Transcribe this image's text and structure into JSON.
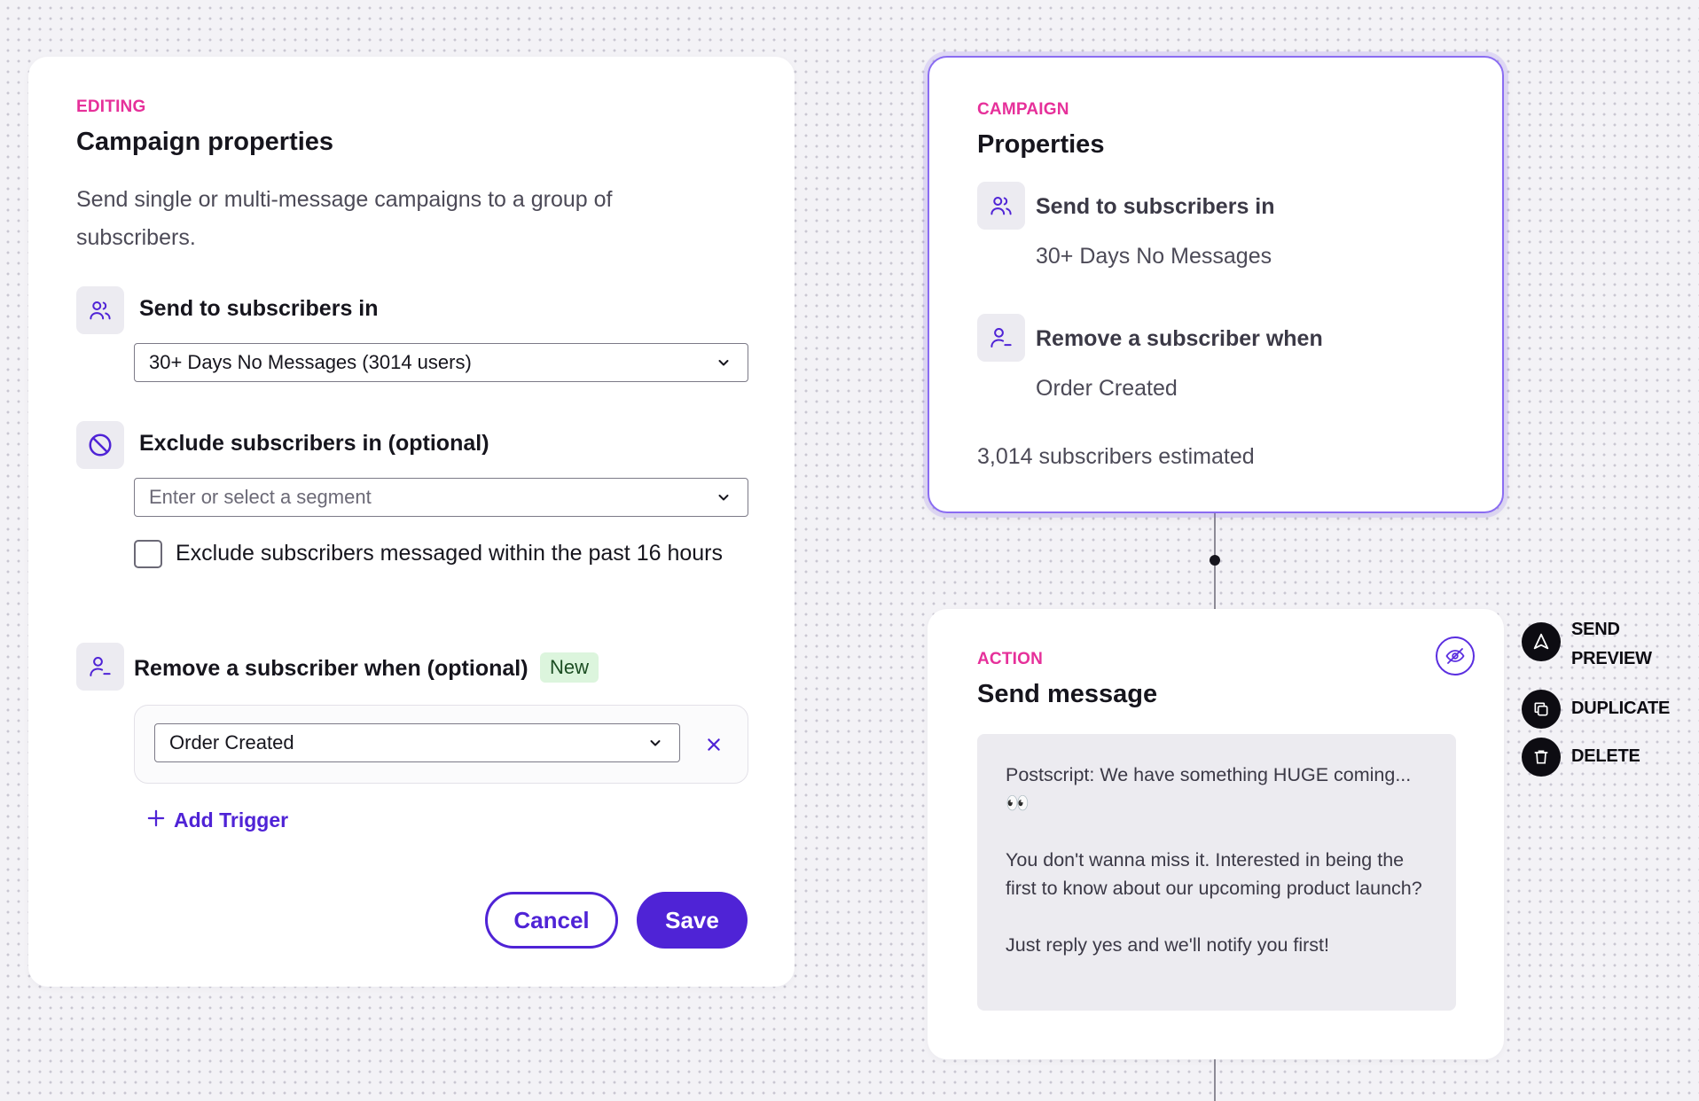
{
  "editor": {
    "eyebrow": "EDITING",
    "title": "Campaign properties",
    "description": "Send single or multi-message campaigns to a group of subscribers.",
    "send_to": {
      "label": "Send to subscribers in",
      "selected": "30+ Days No Messages (3014 users)"
    },
    "exclude": {
      "label": "Exclude subscribers in (optional)",
      "placeholder": "Enter or select a segment"
    },
    "recent_exclusion": {
      "label": "Exclude subscribers messaged within the past 16 hours",
      "checked": false
    },
    "remove_when": {
      "label": "Remove a subscriber when (optional)",
      "badge": "New",
      "trigger_selected": "Order Created"
    },
    "add_trigger_label": "Add Trigger",
    "cancel_label": "Cancel",
    "save_label": "Save"
  },
  "properties_card": {
    "eyebrow": "CAMPAIGN",
    "title": "Properties",
    "send_to_label": "Send to subscribers in",
    "send_to_value": "30+ Days No Messages",
    "remove_label": "Remove a subscriber when",
    "remove_value": "Order Created",
    "estimate": "3,014 subscribers estimated"
  },
  "action_card": {
    "eyebrow": "ACTION",
    "title": "Send message",
    "message": [
      "Postscript: We have something HUGE coming... 👀",
      "You don't wanna miss it. Interested in being the first to know about our upcoming product launch?",
      "Just reply yes and we'll notify you first!"
    ]
  },
  "side_actions": [
    {
      "icon": "send-preview-icon",
      "label": "SEND PREVIEW"
    },
    {
      "icon": "duplicate-icon",
      "label": "DUPLICATE"
    },
    {
      "icon": "trash-icon",
      "label": "DELETE"
    }
  ],
  "colors": {
    "accent": "#4f23d6",
    "eyebrow": "#e6309a",
    "selected_border": "#8a6cf2",
    "badge_bg": "#dcf5dd"
  }
}
